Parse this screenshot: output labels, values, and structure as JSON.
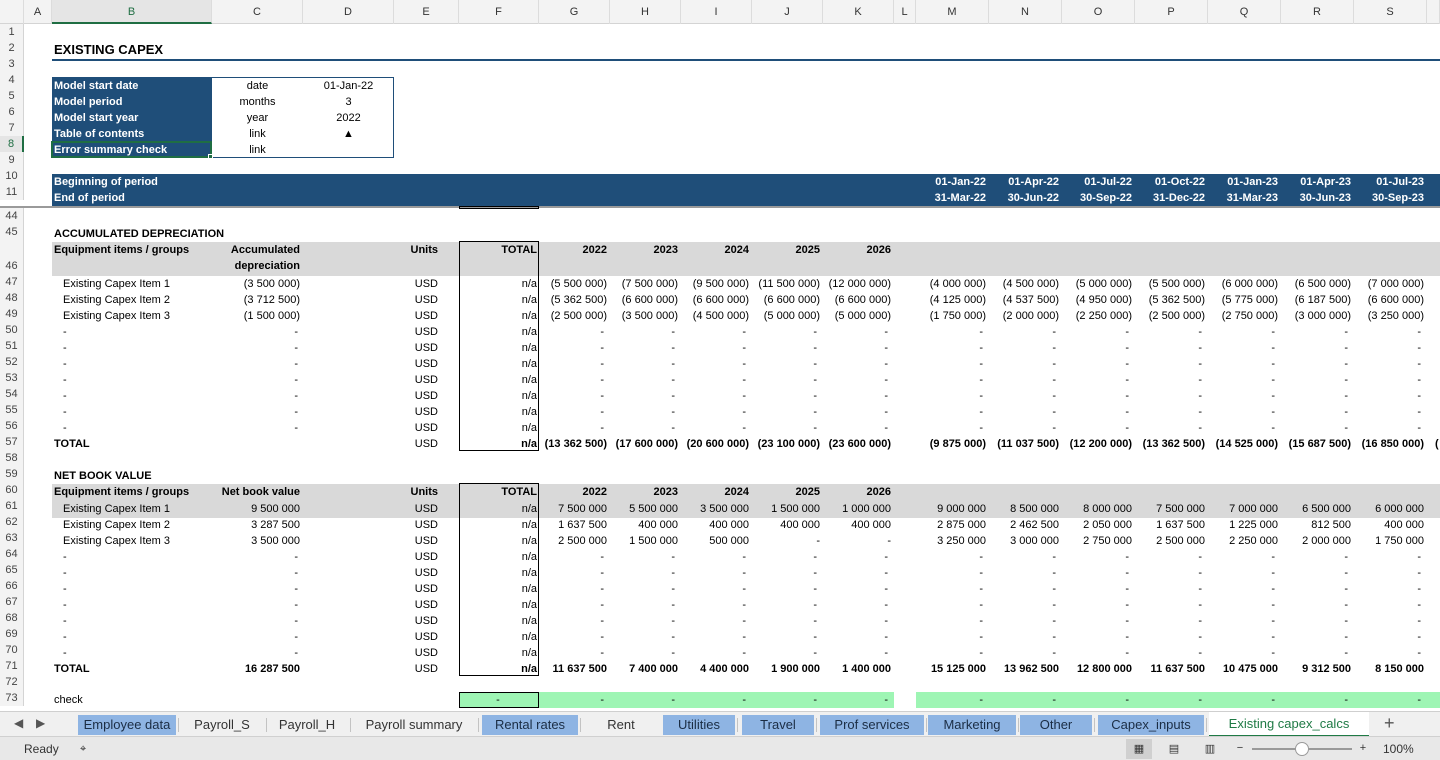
{
  "columns": [
    "A",
    "B",
    "C",
    "D",
    "E",
    "F",
    "G",
    "H",
    "I",
    "J",
    "K",
    "L",
    "M",
    "N",
    "O",
    "P",
    "Q",
    "R",
    "S"
  ],
  "title": "EXISTING CAPEX",
  "info": {
    "rows": [
      {
        "label": "Model start date",
        "unit": "date",
        "value": "01-Jan-22"
      },
      {
        "label": "Model period",
        "unit": "months",
        "value": "3"
      },
      {
        "label": "Model start year",
        "unit": "year",
        "value": "2022"
      },
      {
        "label": "Table of contents",
        "unit": "link",
        "value": "▲"
      },
      {
        "label": "Error summary check",
        "unit": "link",
        "value": ""
      }
    ]
  },
  "period": {
    "begin_label": "Beginning of period",
    "end_label": "End of period",
    "begin": [
      "01-Jan-22",
      "01-Apr-22",
      "01-Jul-22",
      "01-Oct-22",
      "01-Jan-23",
      "01-Apr-23",
      "01-Jul-23"
    ],
    "end": [
      "31-Mar-22",
      "30-Jun-22",
      "30-Sep-22",
      "31-Dec-22",
      "31-Mar-23",
      "30-Jun-23",
      "30-Sep-23"
    ]
  },
  "acc_dep": {
    "heading": "ACCUMULATED DEPRECIATION",
    "hdr_group": "Equipment items / groups",
    "hdr_value_1": "Accumulated",
    "hdr_value_2": "depreciation",
    "hdr_units": "Units",
    "hdr_total": "TOTAL",
    "years": [
      "2022",
      "2023",
      "2024",
      "2025",
      "2026"
    ],
    "rows": [
      {
        "name": "Existing Capex Item 1",
        "value": "(3 500 000)",
        "units": "USD",
        "total": "n/a",
        "years": [
          "(5 500 000)",
          "(7 500 000)",
          "(9 500 000)",
          "(11 500 000)",
          "(12 000 000)"
        ],
        "q": [
          "(4 000 000)",
          "(4 500 000)",
          "(5 000 000)",
          "(5 500 000)",
          "(6 000 000)",
          "(6 500 000)",
          "(7 000 000)"
        ]
      },
      {
        "name": "Existing Capex Item 2",
        "value": "(3 712 500)",
        "units": "USD",
        "total": "n/a",
        "years": [
          "(5 362 500)",
          "(6 600 000)",
          "(6 600 000)",
          "(6 600 000)",
          "(6 600 000)"
        ],
        "q": [
          "(4 125 000)",
          "(4 537 500)",
          "(4 950 000)",
          "(5 362 500)",
          "(5 775 000)",
          "(6 187 500)",
          "(6 600 000)"
        ]
      },
      {
        "name": "Existing Capex Item 3",
        "value": "(1 500 000)",
        "units": "USD",
        "total": "n/a",
        "years": [
          "(2 500 000)",
          "(3 500 000)",
          "(4 500 000)",
          "(5 000 000)",
          "(5 000 000)"
        ],
        "q": [
          "(1 750 000)",
          "(2 000 000)",
          "(2 250 000)",
          "(2 500 000)",
          "(2 750 000)",
          "(3 000 000)",
          "(3 250 000)"
        ]
      }
    ],
    "total": {
      "label": "TOTAL",
      "units": "USD",
      "total": "n/a",
      "years": [
        "(13 362 500)",
        "(17 600 000)",
        "(20 600 000)",
        "(23 100 000)",
        "(23 600 000)"
      ],
      "q": [
        "(9 875 000)",
        "(11 037 500)",
        "(12 200 000)",
        "(13 362 500)",
        "(14 525 000)",
        "(15 687 500)",
        "(16 850 000)"
      ],
      "overflow": "("
    }
  },
  "nbv": {
    "heading": "NET BOOK VALUE",
    "hdr_group": "Equipment items / groups",
    "hdr_value": "Net book value",
    "hdr_units": "Units",
    "hdr_total": "TOTAL",
    "years": [
      "2022",
      "2023",
      "2024",
      "2025",
      "2026"
    ],
    "rows": [
      {
        "name": "Existing Capex Item 1",
        "value": "9 500 000",
        "units": "USD",
        "total": "n/a",
        "years": [
          "7 500 000",
          "5 500 000",
          "3 500 000",
          "1 500 000",
          "1 000 000"
        ],
        "q": [
          "9 000 000",
          "8 500 000",
          "8 000 000",
          "7 500 000",
          "7 000 000",
          "6 500 000",
          "6 000 000"
        ]
      },
      {
        "name": "Existing Capex Item 2",
        "value": "3 287 500",
        "units": "USD",
        "total": "n/a",
        "years": [
          "1 637 500",
          "400 000",
          "400 000",
          "400 000",
          "400 000"
        ],
        "q": [
          "2 875 000",
          "2 462 500",
          "2 050 000",
          "1 637 500",
          "1 225 000",
          "812 500",
          "400 000"
        ]
      },
      {
        "name": "Existing Capex Item 3",
        "value": "3 500 000",
        "units": "USD",
        "total": "n/a",
        "years": [
          "2 500 000",
          "1 500 000",
          "500 000",
          "-",
          "-"
        ],
        "q": [
          "3 250 000",
          "3 000 000",
          "2 750 000",
          "2 500 000",
          "2 250 000",
          "2 000 000",
          "1 750 000"
        ]
      }
    ],
    "total": {
      "label": "TOTAL",
      "value": "16 287 500",
      "units": "USD",
      "total": "n/a",
      "years": [
        "11 637 500",
        "7 400 000",
        "4 400 000",
        "1 900 000",
        "1 400 000"
      ],
      "q": [
        "15 125 000",
        "13 962 500",
        "12 800 000",
        "11 637 500",
        "10 475 000",
        "9 312 500",
        "8 150 000"
      ]
    }
  },
  "blank": {
    "dash": "-",
    "units": "USD",
    "total": "n/a"
  },
  "check": {
    "label": "check",
    "dash": "-"
  },
  "tabs": [
    {
      "label": "Employee data",
      "style": "blue"
    },
    {
      "label": "Payroll_S",
      "style": "plain"
    },
    {
      "label": "Payroll_H",
      "style": "plain"
    },
    {
      "label": "Payroll summary",
      "style": "plain"
    },
    {
      "label": "Rental rates",
      "style": "blue"
    },
    {
      "label": "Rent",
      "style": "plain"
    },
    {
      "label": "Utilities",
      "style": "blue"
    },
    {
      "label": "Travel",
      "style": "blue"
    },
    {
      "label": "Prof services",
      "style": "blue"
    },
    {
      "label": "Marketing",
      "style": "blue"
    },
    {
      "label": "Other",
      "style": "blue"
    },
    {
      "label": "Capex_inputs",
      "style": "blue"
    },
    {
      "label": "Existing capex_calcs",
      "style": "active"
    }
  ],
  "status": {
    "ready": "Ready",
    "zoom": "100%"
  },
  "colors": {
    "navy": "#1f4e79",
    "green_check": "#9ef5b4",
    "tab_blue": "#8eb4e3",
    "excel_green": "#1f6e43"
  },
  "icons": [
    "scroll-left-icon",
    "scroll-right-icon",
    "add-sheet-icon",
    "accessibility-icon",
    "normal-view-icon",
    "page-layout-icon",
    "page-break-icon",
    "zoom-out-icon",
    "zoom-in-icon",
    "traffic-light-icon"
  ]
}
